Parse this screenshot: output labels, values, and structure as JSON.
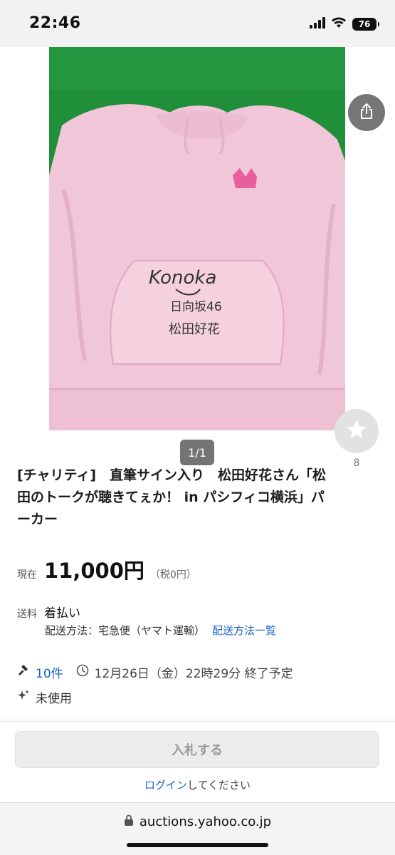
{
  "status_bar": {
    "time": "22:46",
    "battery": "76"
  },
  "gallery": {
    "counter": "1/1",
    "signature_text": [
      "Konoka",
      "日向坂46",
      "松田好花"
    ]
  },
  "watch": {
    "count": "8"
  },
  "item": {
    "title": "[チャリティ]　直筆サイン入り　松田好花さん「松田のトークが聴きてぇか！ in パシフィコ横浜」パーカー",
    "price_label": "現在",
    "price": "11,000円",
    "tax": "（税0円）",
    "shipping_label": "送料",
    "shipping_value": "着払い",
    "shipping_method": "配送方法：宅急便（ヤマト運輸）",
    "shipping_link": "配送方法一覧",
    "bids": "10件",
    "end_time": "12月26日（金）22時29分 終了予定",
    "condition": "未使用"
  },
  "actions": {
    "bid_button": "入札する",
    "login_link": "ログイン",
    "login_suffix": "してください"
  },
  "browser": {
    "url": "auctions.yahoo.co.jp"
  },
  "colors": {
    "link": "#1b66c9",
    "background_green": "#1f8f3a",
    "hoodie_pink": "#f2c9d9"
  }
}
